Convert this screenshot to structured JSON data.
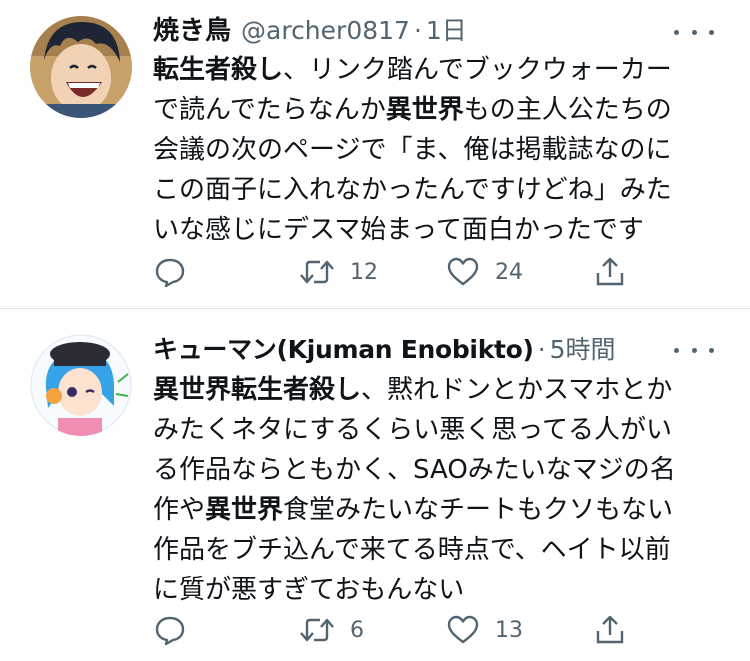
{
  "tweets": [
    {
      "name": "焼き鳥",
      "handle": "@archer0817",
      "separator": "·",
      "time": "1日",
      "body": {
        "l1_b": "転生者殺し",
        "l1_t": "、リンク踏んでブックウォーカー",
        "l2_t1": "で読んでたらなんか",
        "l2_b": "異世界",
        "l2_t2": "もの主人公たちの",
        "l3": "会議の次のページで「ま、俺は掲載誌なのに",
        "l4": "この面子に入れなかったんですけどね」みた",
        "l5": "いな感じにデスマ始まって面白かったです"
      },
      "replies": "",
      "retweets": "12",
      "likes": "24"
    },
    {
      "name": "キューマン(Kjuman Enobikto)",
      "separator": "·",
      "time": "5時間",
      "body": {
        "l1_b": "異世界転生者殺し",
        "l1_t": "、黙れドンとかスマホとか",
        "l2": "みたくネタにするくらい悪く思ってる人がい",
        "l3": "る作品ならともかく、SAOみたいなマジの名",
        "l4_t1": "作や",
        "l4_b": "異世界",
        "l4_t2": "食堂みたいなチートもクソもない",
        "l5": "作品をブチ込んで来てる時点で、ヘイト以前",
        "l6": "に質が悪すぎておもんない"
      },
      "replies": "",
      "retweets": "6",
      "likes": "13"
    }
  ],
  "icons": {
    "reply": "reply-icon",
    "retweet": "retweet-icon",
    "like": "heart-icon",
    "share": "share-icon",
    "more": "more-icon"
  },
  "colors": {
    "text": "#0f1419",
    "secondary": "#536471",
    "divider": "#e1e6ea"
  }
}
